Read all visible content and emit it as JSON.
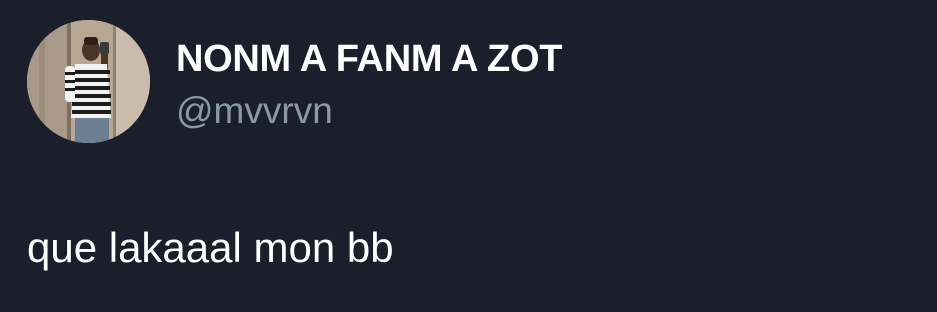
{
  "author": {
    "display_name": "NONM A FANM A ZOT",
    "handle": "@mvvrvn",
    "avatar_icon": "profile-photo"
  },
  "tweet": {
    "text": "que lakaaal mon bb"
  },
  "colors": {
    "background": "#1a1f2b",
    "primary_text": "#ffffff",
    "secondary_text": "#8b98a5"
  }
}
